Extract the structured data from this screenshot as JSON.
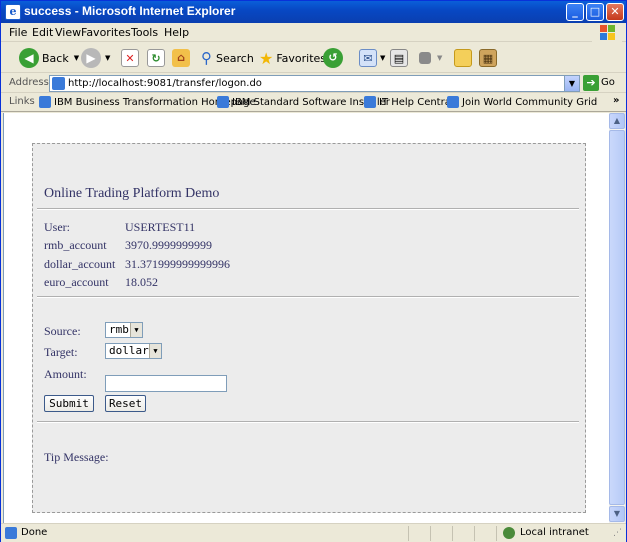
{
  "window": {
    "title": "success - Microsoft Internet Explorer",
    "app_icon_glyph": "e"
  },
  "menu": [
    "File",
    "Edit",
    "View",
    "Favorites",
    "Tools",
    "Help"
  ],
  "toolbar": {
    "back_label": "Back",
    "search_label": "Search",
    "favorites_label": "Favorites"
  },
  "address": {
    "label": "Address",
    "url": "http://localhost:9081/transfer/logon.do",
    "go_label": "Go"
  },
  "links": {
    "label": "Links",
    "items": [
      "IBM Business Transformation Homepage",
      "IBM Standard Software Installer",
      "IT Help Central",
      "Join World Community Grid"
    ]
  },
  "page": {
    "title": "Online Trading Platform Demo",
    "account": [
      {
        "label": "User:",
        "value": "USERTEST11"
      },
      {
        "label": "rmb_account",
        "value": "3970.9999999999"
      },
      {
        "label": "dollar_account",
        "value": "31.371999999999996"
      },
      {
        "label": "euro_account",
        "value": "18.052"
      }
    ],
    "form": {
      "source_label": "Source:",
      "source_value": "rmb",
      "target_label": "Target:",
      "target_value": "dollar",
      "amount_label": "Amount:",
      "amount_value": "",
      "submit_label": "Submit",
      "reset_label": "Reset"
    },
    "tip_label": "Tip Message:"
  },
  "status": {
    "text": "Done",
    "zone": "Local intranet"
  },
  "colors": {
    "titlebar": "#0a5fd9",
    "page_text": "#333366",
    "panel_bg": "#ececec"
  }
}
